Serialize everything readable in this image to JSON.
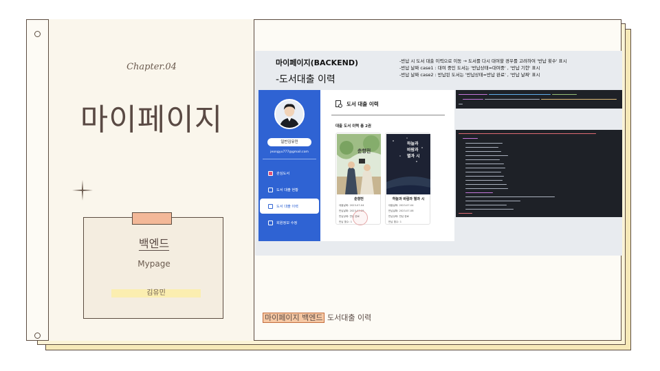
{
  "left_page": {
    "chapter": "Chapter.04",
    "title": "마이페이지",
    "card": {
      "title": "백엔드",
      "subtitle": "Mypage",
      "author": "김유민"
    }
  },
  "panel": {
    "title": "마이페이지(BACKEND)",
    "subtitle": "-도서대출 이력",
    "notes": [
      "-반납 시 도서 대출 이력으로 이동 → 도서를 다시 대여할 경우를 고려하여 '반납 횟수' 표시",
      "-반납 날짜 case1 : 대여 중인 도서는 '반납상태=대여중' , '반납 기한' 표시",
      "-반납 날짜 case2 : 반납된 도서는 '반납상태=반납 완료' , '반납 날짜' 표시"
    ]
  },
  "app": {
    "user_name": "일반김유민",
    "email": "jeongyu777@gmail.com",
    "nav": [
      {
        "label": "관심도서",
        "active": false
      },
      {
        "label": "도서 대출 현황",
        "active": false
      },
      {
        "label": "도서 대출 이력",
        "active": true
      },
      {
        "label": "회원정보 수정",
        "active": false
      }
    ],
    "header": "도서 대출 이력",
    "count_label": "대출 도서 이력 총 2권",
    "books": [
      {
        "cover_text": "춘향전",
        "title": "춘향전",
        "rent_label": "대출날짜:",
        "rent_date": "2023-07-04",
        "return_label": "반납날짜:",
        "return_date": "2023-07-25",
        "status_label": "반납상태:",
        "status": "반납 완료",
        "count_label": "반납 횟수:",
        "count": "1"
      },
      {
        "cover_text": "하늘과 바람과 별과 시",
        "title": "하늘과 바람과 별과 시",
        "rent_label": "대출날짜:",
        "rent_date": "2023-07-04",
        "return_label": "반납날짜:",
        "return_date": "2023-07-08",
        "status_label": "반납상태:",
        "status": "반납 완료",
        "count_label": "반납 횟수:",
        "count": "1"
      }
    ]
  },
  "caption": {
    "highlight": "마이페이지 백엔드",
    "rest": " 도서대출 이력"
  },
  "colors": {
    "accent_blue": "#2f63d3",
    "highlight": "#f6c8a4",
    "card_author_bg": "#fbeeb0",
    "code_bg": "#1e2127"
  }
}
